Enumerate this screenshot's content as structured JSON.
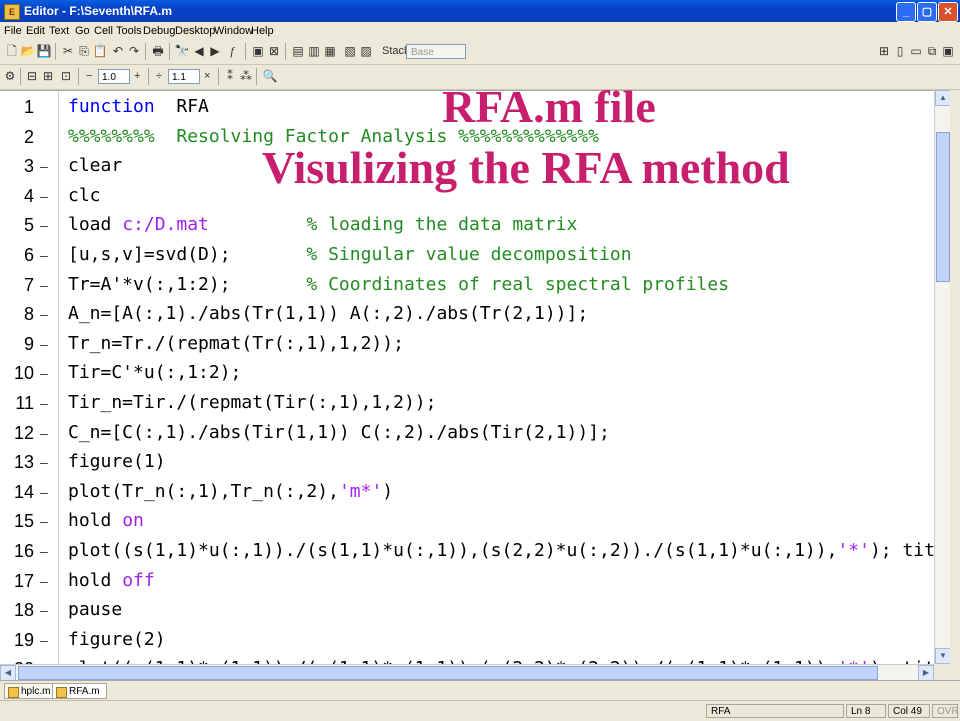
{
  "window": {
    "title": "Editor - F:\\Seventh\\RFA.m"
  },
  "menu": [
    "File",
    "Edit",
    "Text",
    "Go",
    "Cell",
    "Tools",
    "Debug",
    "Desktop",
    "Window",
    "Help"
  ],
  "toolbar": {
    "stack_label": "Stack:",
    "stack_value": "Base",
    "cell_value_1": "1.0",
    "cell_value_2": "1.1",
    "minus": "−",
    "plus": "+",
    "times": "×",
    "divide": "÷"
  },
  "overlay": {
    "title": "RFA.m file",
    "subtitle": "Visulizing the RFA method"
  },
  "lines": [
    {
      "num": "1",
      "dash": "",
      "segments": [
        {
          "t": "function",
          "c": "kw"
        },
        {
          "t": "  RFA",
          "c": ""
        }
      ]
    },
    {
      "num": "2",
      "dash": "",
      "segments": [
        {
          "t": "%%%%%%%%  Resolving Factor Analysis %%%%%%%%%%%%%",
          "c": "cmt"
        }
      ]
    },
    {
      "num": "3",
      "dash": "–",
      "segments": [
        {
          "t": "clear",
          "c": ""
        }
      ]
    },
    {
      "num": "4",
      "dash": "–",
      "segments": [
        {
          "t": "clc",
          "c": ""
        }
      ]
    },
    {
      "num": "5",
      "dash": "–",
      "segments": [
        {
          "t": "load ",
          "c": ""
        },
        {
          "t": "c:/D.mat",
          "c": "str"
        },
        {
          "t": "         ",
          "c": ""
        },
        {
          "t": "% loading the data matrix",
          "c": "cmt"
        }
      ]
    },
    {
      "num": "6",
      "dash": "–",
      "segments": [
        {
          "t": "[u,s,v]=svd(D);       ",
          "c": ""
        },
        {
          "t": "% Singular value decomposition",
          "c": "cmt"
        }
      ]
    },
    {
      "num": "7",
      "dash": "–",
      "segments": [
        {
          "t": "Tr=A'*v(:,1:2);       ",
          "c": ""
        },
        {
          "t": "% Coordinates of real spectral profiles",
          "c": "cmt"
        }
      ]
    },
    {
      "num": "8",
      "dash": "–",
      "segments": [
        {
          "t": "A_n=[A(:,1)./abs(Tr(1,1)) A(:,2)./abs(Tr(2,1))];",
          "c": ""
        }
      ]
    },
    {
      "num": "9",
      "dash": "–",
      "segments": [
        {
          "t": "Tr_n=Tr./(repmat(Tr(:,1),1,2));",
          "c": ""
        }
      ]
    },
    {
      "num": "10",
      "dash": "–",
      "segments": [
        {
          "t": "Tir=C'*u(:,1:2);",
          "c": ""
        }
      ]
    },
    {
      "num": "11",
      "dash": "–",
      "segments": [
        {
          "t": "Tir_n=Tir./(repmat(Tir(:,1),1,2));",
          "c": ""
        }
      ]
    },
    {
      "num": "12",
      "dash": "–",
      "segments": [
        {
          "t": "C_n=[C(:,1)./abs(Tir(1,1)) C(:,2)./abs(Tir(2,1))];",
          "c": ""
        }
      ]
    },
    {
      "num": "13",
      "dash": "–",
      "segments": [
        {
          "t": "figure(1)",
          "c": ""
        }
      ]
    },
    {
      "num": "14",
      "dash": "–",
      "segments": [
        {
          "t": "plot(Tr_n(:,1),Tr_n(:,2),",
          "c": ""
        },
        {
          "t": "'m*'",
          "c": "str"
        },
        {
          "t": ")",
          "c": ""
        }
      ]
    },
    {
      "num": "15",
      "dash": "–",
      "segments": [
        {
          "t": "hold ",
          "c": ""
        },
        {
          "t": "on",
          "c": "str"
        }
      ]
    },
    {
      "num": "16",
      "dash": "–",
      "segments": [
        {
          "t": "plot((s(1,1)*u(:,1))./(s(1,1)*u(:,1)),(s(2,2)*u(:,2))./(s(1,1)*u(:,1)),",
          "c": ""
        },
        {
          "t": "'*'",
          "c": "str"
        },
        {
          "t": "); title(",
          "c": ""
        }
      ]
    },
    {
      "num": "17",
      "dash": "–",
      "segments": [
        {
          "t": "hold ",
          "c": ""
        },
        {
          "t": "off",
          "c": "str"
        }
      ]
    },
    {
      "num": "18",
      "dash": "–",
      "segments": [
        {
          "t": "pause",
          "c": ""
        }
      ]
    },
    {
      "num": "19",
      "dash": "–",
      "segments": [
        {
          "t": "figure(2)",
          "c": ""
        }
      ]
    },
    {
      "num": "20",
      "dash": "–",
      "segments": [
        {
          "t": "plot((s(1,1)*u(1,1))./(s(1,1)*u(1,1)),(s(2,2)*u(2,2))./(s(1,1)*u(1,1)),",
          "c": ""
        },
        {
          "t": "'*'",
          "c": "str"
        },
        {
          "t": "); title",
          "c": ""
        }
      ]
    }
  ],
  "tabs": [
    {
      "label": "hplc.m",
      "active": false
    },
    {
      "label": "RFA.m",
      "active": true
    }
  ],
  "status": {
    "file": "RFA",
    "ln_label": "Ln",
    "ln_value": "8",
    "col_label": "Col",
    "col_value": "49",
    "ovr": "OVR"
  }
}
